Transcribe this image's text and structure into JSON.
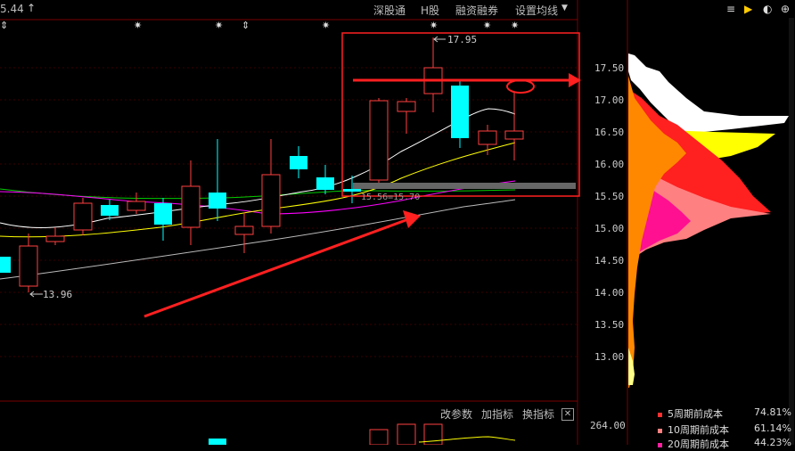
{
  "topbar": {
    "price_fragment": "5.44",
    "items": [
      "深股通",
      "H股",
      "融资融券",
      "设置均线"
    ]
  },
  "right_icons": [
    "≡",
    "▶",
    "◐",
    "⊕"
  ],
  "price_axis": {
    "ticks": [
      "17.50",
      "17.00",
      "16.50",
      "16.00",
      "15.50",
      "15.00",
      "14.50",
      "14.00",
      "13.50",
      "13.00"
    ]
  },
  "annotations": {
    "high_label": "17.95",
    "low_label": "13.96",
    "mid_label": "15.56=15.70"
  },
  "volume_toolbar": {
    "items": [
      "改参数",
      "加指标",
      "换指标"
    ],
    "close": "✕",
    "axis_value": "264.00"
  },
  "cost_legend": [
    {
      "label": "5周期前成本",
      "value": "74.81%",
      "color": "#ff3030"
    },
    {
      "label": "10周期前成本",
      "value": "61.14%",
      "color": "#ff8080"
    },
    {
      "label": "20周期前成本",
      "value": "44.23%",
      "color": "#ff20a0"
    }
  ],
  "colors": {
    "up": "#ff4040",
    "down": "#00ffff",
    "ma5": "#ffffff",
    "ma10": "#ffff00",
    "ma20": "#ff00ff",
    "ma60": "#00cc00",
    "annotation": "#ff2020"
  }
}
